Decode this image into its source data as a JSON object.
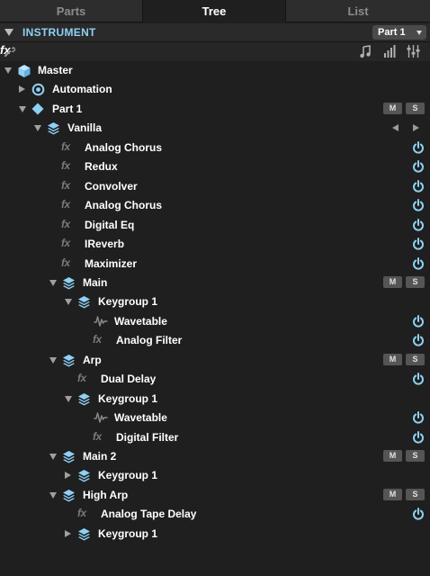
{
  "tabs": [
    "Parts",
    "Tree",
    "List"
  ],
  "active_tab": "Tree",
  "instrument": {
    "title": "INSTRUMENT",
    "part_select": "Part 1"
  },
  "toolbar": {
    "icons": [
      "wrench-icon",
      "fx-icon",
      "note-icon",
      "bars-icon",
      "sliders-icon"
    ],
    "fx_label": "fx"
  },
  "accent_color": "#8fd0f5",
  "mute_label": "M",
  "solo_label": "S",
  "fx_glyph": "fx",
  "tree": [
    {
      "label": "Master",
      "icon": "cube-icon",
      "expand": "down"
    },
    {
      "label": "Automation",
      "icon": "target-icon",
      "expand": "right"
    },
    {
      "label": "Part 1",
      "icon": "diamond-icon",
      "expand": "down",
      "ms": true
    },
    {
      "label": "Vanilla",
      "icon": "layers-icon",
      "expand": "down",
      "nav_arrows": true
    },
    {
      "label": "Analog Chorus",
      "icon": "fx",
      "power": true
    },
    {
      "label": "Redux",
      "icon": "fx",
      "power": true
    },
    {
      "label": "Convolver",
      "icon": "fx",
      "power": true
    },
    {
      "label": "Analog Chorus",
      "icon": "fx",
      "power": true
    },
    {
      "label": "Digital Eq",
      "icon": "fx",
      "power": true
    },
    {
      "label": "IReverb",
      "icon": "fx",
      "power": true
    },
    {
      "label": "Maximizer",
      "icon": "fx",
      "power": true
    },
    {
      "label": "Main",
      "icon": "layers-icon",
      "expand": "down",
      "ms": true
    },
    {
      "label": "Keygroup 1",
      "icon": "layers-icon",
      "expand": "down"
    },
    {
      "label": "Wavetable",
      "icon": "waveform-icon",
      "power": true
    },
    {
      "label": "Analog Filter",
      "icon": "fx",
      "power": true
    },
    {
      "label": "Arp",
      "icon": "layers-icon",
      "expand": "down",
      "ms": true
    },
    {
      "label": "Dual Delay",
      "icon": "fx",
      "power": true
    },
    {
      "label": "Keygroup 1",
      "icon": "layers-icon",
      "expand": "down"
    },
    {
      "label": "Wavetable",
      "icon": "waveform-icon",
      "power": true
    },
    {
      "label": "Digital Filter",
      "icon": "fx",
      "power": true
    },
    {
      "label": "Main 2",
      "icon": "layers-icon",
      "expand": "down",
      "ms": true
    },
    {
      "label": "Keygroup 1",
      "icon": "layers-icon",
      "expand": "right"
    },
    {
      "label": "High Arp",
      "icon": "layers-icon",
      "expand": "down",
      "ms": true
    },
    {
      "label": "Analog Tape Delay",
      "icon": "fx",
      "power": true
    },
    {
      "label": "Keygroup 1",
      "icon": "layers-icon",
      "expand": "right"
    }
  ]
}
